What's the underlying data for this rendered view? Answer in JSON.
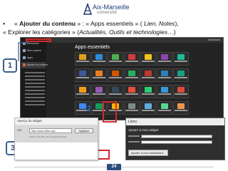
{
  "logo": {
    "line1": "Aix-Marseille",
    "line2": "université"
  },
  "heading": {
    "bullet": "•",
    "line1_prefix": "« ",
    "line1_bold": "Ajouter du contenu",
    "line1_mid": " » : « Apps essentiels » ( ",
    "line1_italic": "Lien, Notes",
    "line1_suffix": "),",
    "line2_prefix": "« Explorer les catégories » (",
    "line2_italic": "Actualités, Outils et technologies",
    "line2_suffix": "…)"
  },
  "screenshot": {
    "panel_title": "Apps essentiels",
    "topbar_right": "Dashboard",
    "sidebar_items": [
      {
        "label": "Bienvenue"
      },
      {
        "label": "Mon contenu"
      },
      {
        "label": "Apps"
      },
      {
        "label": "Ajouter du contenu"
      }
    ],
    "tile_colors": [
      "#e0a020",
      "#2e8bd8",
      "#4caf50",
      "#d33c3c",
      "#f0c419",
      "#8e44ad",
      "#1abc9c",
      "#3b5998",
      "#e67e22",
      "#d35400",
      "#27ae60",
      "#c0392b",
      "#2980b9",
      "#16a085",
      "#f39c12",
      "#9b59b6",
      "#34495e",
      "#e74c3c",
      "#2ecc71",
      "#3498db",
      "#dd4b39",
      "#4285f4",
      "#0f9d58",
      "#f4b400",
      "#7f8c8d",
      "#5dade2",
      "#58d68d",
      "#eb984e"
    ]
  },
  "badges": {
    "one": "1",
    "two": "2",
    "three": "3"
  },
  "overlay_left": {
    "title": "Aperçu du widget",
    "url_label": "URL",
    "url_value": "http://www.dfhe.org/",
    "apply_label": "Appliquer",
    "hint": "Choisir une URL pour la page d'accueil"
  },
  "overlay_right": {
    "title": "Liens",
    "subtitle": "Ajouter à mon widget",
    "add_button": "Ajouter à mon dashboard"
  },
  "page_number": "24"
}
